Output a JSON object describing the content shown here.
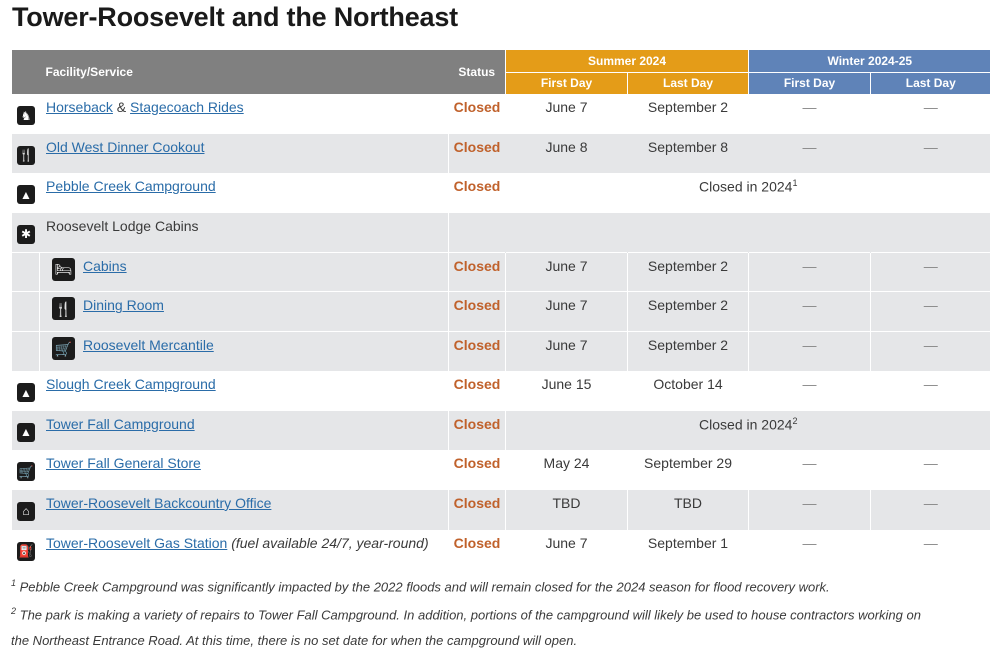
{
  "page_title": "Tower-Roosevelt and the Northeast",
  "table": {
    "headers": {
      "facility": "Facility/Service",
      "status": "Status",
      "summer": "Summer 2024",
      "winter": "Winter 2024-25",
      "summer_first": "First Day",
      "summer_last": "Last Day",
      "winter_first": "First Day",
      "winter_last": "Last Day"
    },
    "colors": {
      "header_gray": "#808080",
      "summer": "#e49c18",
      "winter": "#5f83b8",
      "status_closed": "#c0612b",
      "link": "#2a6ca8",
      "row_alt": "#e5e6e8"
    },
    "rows": [
      {
        "icon": "horseback-icon",
        "name_a": "Horseback",
        "joiner": " & ",
        "name_b": "Stagecoach Rides",
        "status": "Closed",
        "summer_first": "June 7",
        "summer_last": "September 2",
        "winter_first": "—",
        "winter_last": "—"
      },
      {
        "icon": "dining-icon",
        "name": "Old West Dinner Cookout",
        "status": "Closed",
        "summer_first": "June 8",
        "summer_last": "September 8",
        "winter_first": "—",
        "winter_last": "—"
      },
      {
        "icon": "campground-icon",
        "name": "Pebble Creek Campground",
        "status": "Closed",
        "merged_text": "Closed in 2024",
        "footnote_ref": "1"
      },
      {
        "icon": "lodging-icon",
        "name": "Roosevelt Lodge Cabins"
      },
      {
        "icon": "bed-icon",
        "name": "Cabins",
        "status": "Closed",
        "summer_first": "June 7",
        "summer_last": "September 2",
        "winter_first": "—",
        "winter_last": "—"
      },
      {
        "icon": "dining-icon",
        "name": "Dining Room",
        "status": "Closed",
        "summer_first": "June 7",
        "summer_last": "September 2",
        "winter_first": "—",
        "winter_last": "—"
      },
      {
        "icon": "store-icon",
        "name": "Roosevelt Mercantile",
        "status": "Closed",
        "summer_first": "June 7",
        "summer_last": "September 2",
        "winter_first": "—",
        "winter_last": "—"
      },
      {
        "icon": "campground-icon",
        "name": "Slough Creek Campground",
        "status": "Closed",
        "summer_first": "June 15",
        "summer_last": "October 14",
        "winter_first": "—",
        "winter_last": "—"
      },
      {
        "icon": "campground-icon",
        "name": "Tower Fall Campground",
        "status": "Closed",
        "merged_text": "Closed in 2024",
        "footnote_ref": "2"
      },
      {
        "icon": "store-icon",
        "name": "Tower Fall General Store",
        "status": "Closed",
        "summer_first": "May 24",
        "summer_last": "September 29",
        "winter_first": "—",
        "winter_last": "—"
      },
      {
        "icon": "ranger-station-icon",
        "name": "Tower-Roosevelt Backcountry Office",
        "status": "Closed",
        "summer_first": "TBD",
        "summer_last": "TBD",
        "winter_first": "—",
        "winter_last": "—"
      },
      {
        "icon": "gas-station-icon",
        "name": "Tower-Roosevelt Gas Station",
        "note": "(fuel available 24/7, year-round)",
        "status": "Closed",
        "summer_first": "June 7",
        "summer_last": "September 1",
        "winter_first": "—",
        "winter_last": "—"
      }
    ]
  },
  "footnotes": [
    {
      "ref": "1",
      "text": " Pebble Creek Campground was significantly impacted by the 2022 floods and will remain closed for the 2024 season for flood recovery work."
    },
    {
      "ref": "2",
      "text": " The park is making a variety of repairs to Tower Fall Campground. In addition, portions of the campground will likely be used to house contractors working on"
    },
    {
      "ref": "",
      "text": "the Northeast Entrance Road. At this time, there is no set date for when the campground will open."
    }
  ]
}
